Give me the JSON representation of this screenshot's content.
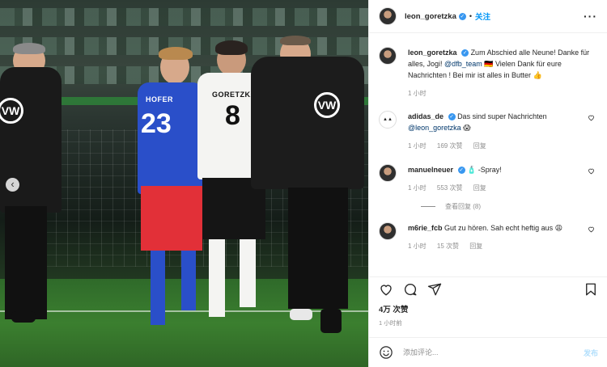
{
  "photo": {
    "left_player_number": "23",
    "left_player_name": "HOFER",
    "center_player_number": "8",
    "center_player_name": "GORETZKA",
    "logo_text": "VW"
  },
  "header": {
    "username": "leon_goretzka",
    "follow_label": "关注",
    "more_icon": "more-horizontal-icon"
  },
  "caption": {
    "username": "leon_goretzka",
    "text_1": "Zum Abschied alle Neune! Danke für alles, Jogi!",
    "mention": "@dfb_team",
    "text_2": "🇩🇪 Vielen Dank für eure Nachrichten ! Bei mir ist alles in Butter 👍",
    "time": "1 小时"
  },
  "comments": [
    {
      "username": "adidas_de",
      "text": "Das sind super Nachrichten",
      "mention": "@leon_goretzka",
      "emoji": "😱",
      "time": "1 小时",
      "likes": "169 次赞",
      "reply": "回复"
    },
    {
      "username": "manuelneuer",
      "text": "-Spray!",
      "emoji": "🧴",
      "time": "1 小时",
      "likes": "553 次赞",
      "reply": "回复",
      "view_replies": "查看回复 (8)"
    },
    {
      "username": "m6rie_fcb",
      "text": "Gut zu hören. Sah echt heftig aus",
      "emoji": "😩",
      "time": "1 小时",
      "likes": "15 次赞",
      "reply": "回复"
    }
  ],
  "stats": {
    "likes": "4万 次赞",
    "posted": "1 小时前"
  },
  "comment_box": {
    "placeholder": "添加评论...",
    "post_label": "发布"
  },
  "colors": {
    "link": "#00376b",
    "follow": "#0095f6",
    "verified": "#3897f0",
    "muted": "#8e8e8e"
  }
}
